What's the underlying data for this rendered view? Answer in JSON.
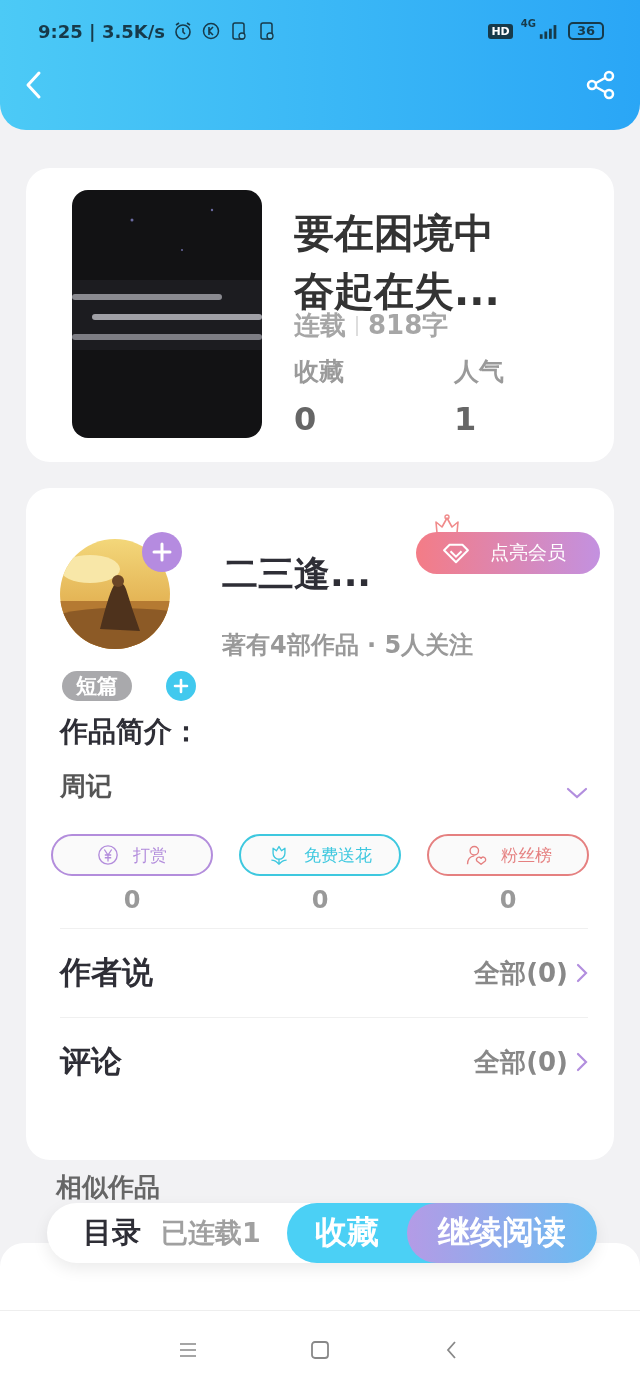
{
  "status_bar": {
    "time": "9:25 | 3.5K/s",
    "hd": "HD",
    "network": "4G",
    "battery": "36"
  },
  "book": {
    "title": "要在困境中奋起在失...",
    "state": "连载",
    "words": "818字",
    "stats": [
      {
        "label": "收藏",
        "value": "0"
      },
      {
        "label": "人气",
        "value": "1"
      }
    ]
  },
  "author": {
    "name": "二三逢...",
    "info": "著有4部作品 · 5人关注",
    "vip_button": "点亮会员"
  },
  "tag": "短篇",
  "intro_label": "作品简介：",
  "intro": "周记",
  "actions": [
    {
      "kind": "reward",
      "label": "打赏",
      "count": "0",
      "color": "#b38ddc"
    },
    {
      "kind": "flower",
      "label": "免费送花",
      "count": "0",
      "color": "#3ec8df"
    },
    {
      "kind": "fans",
      "label": "粉丝榜",
      "count": "0",
      "color": "#e58080"
    }
  ],
  "sections": [
    {
      "title": "作者说",
      "link": "全部(0)"
    },
    {
      "title": "评论",
      "link": "全部(0)"
    }
  ],
  "similar_heading": "相似作品",
  "bottom_bar": {
    "catalog": "目录",
    "chapters": "已连载1",
    "collect": "收藏",
    "read": "继续阅读"
  }
}
